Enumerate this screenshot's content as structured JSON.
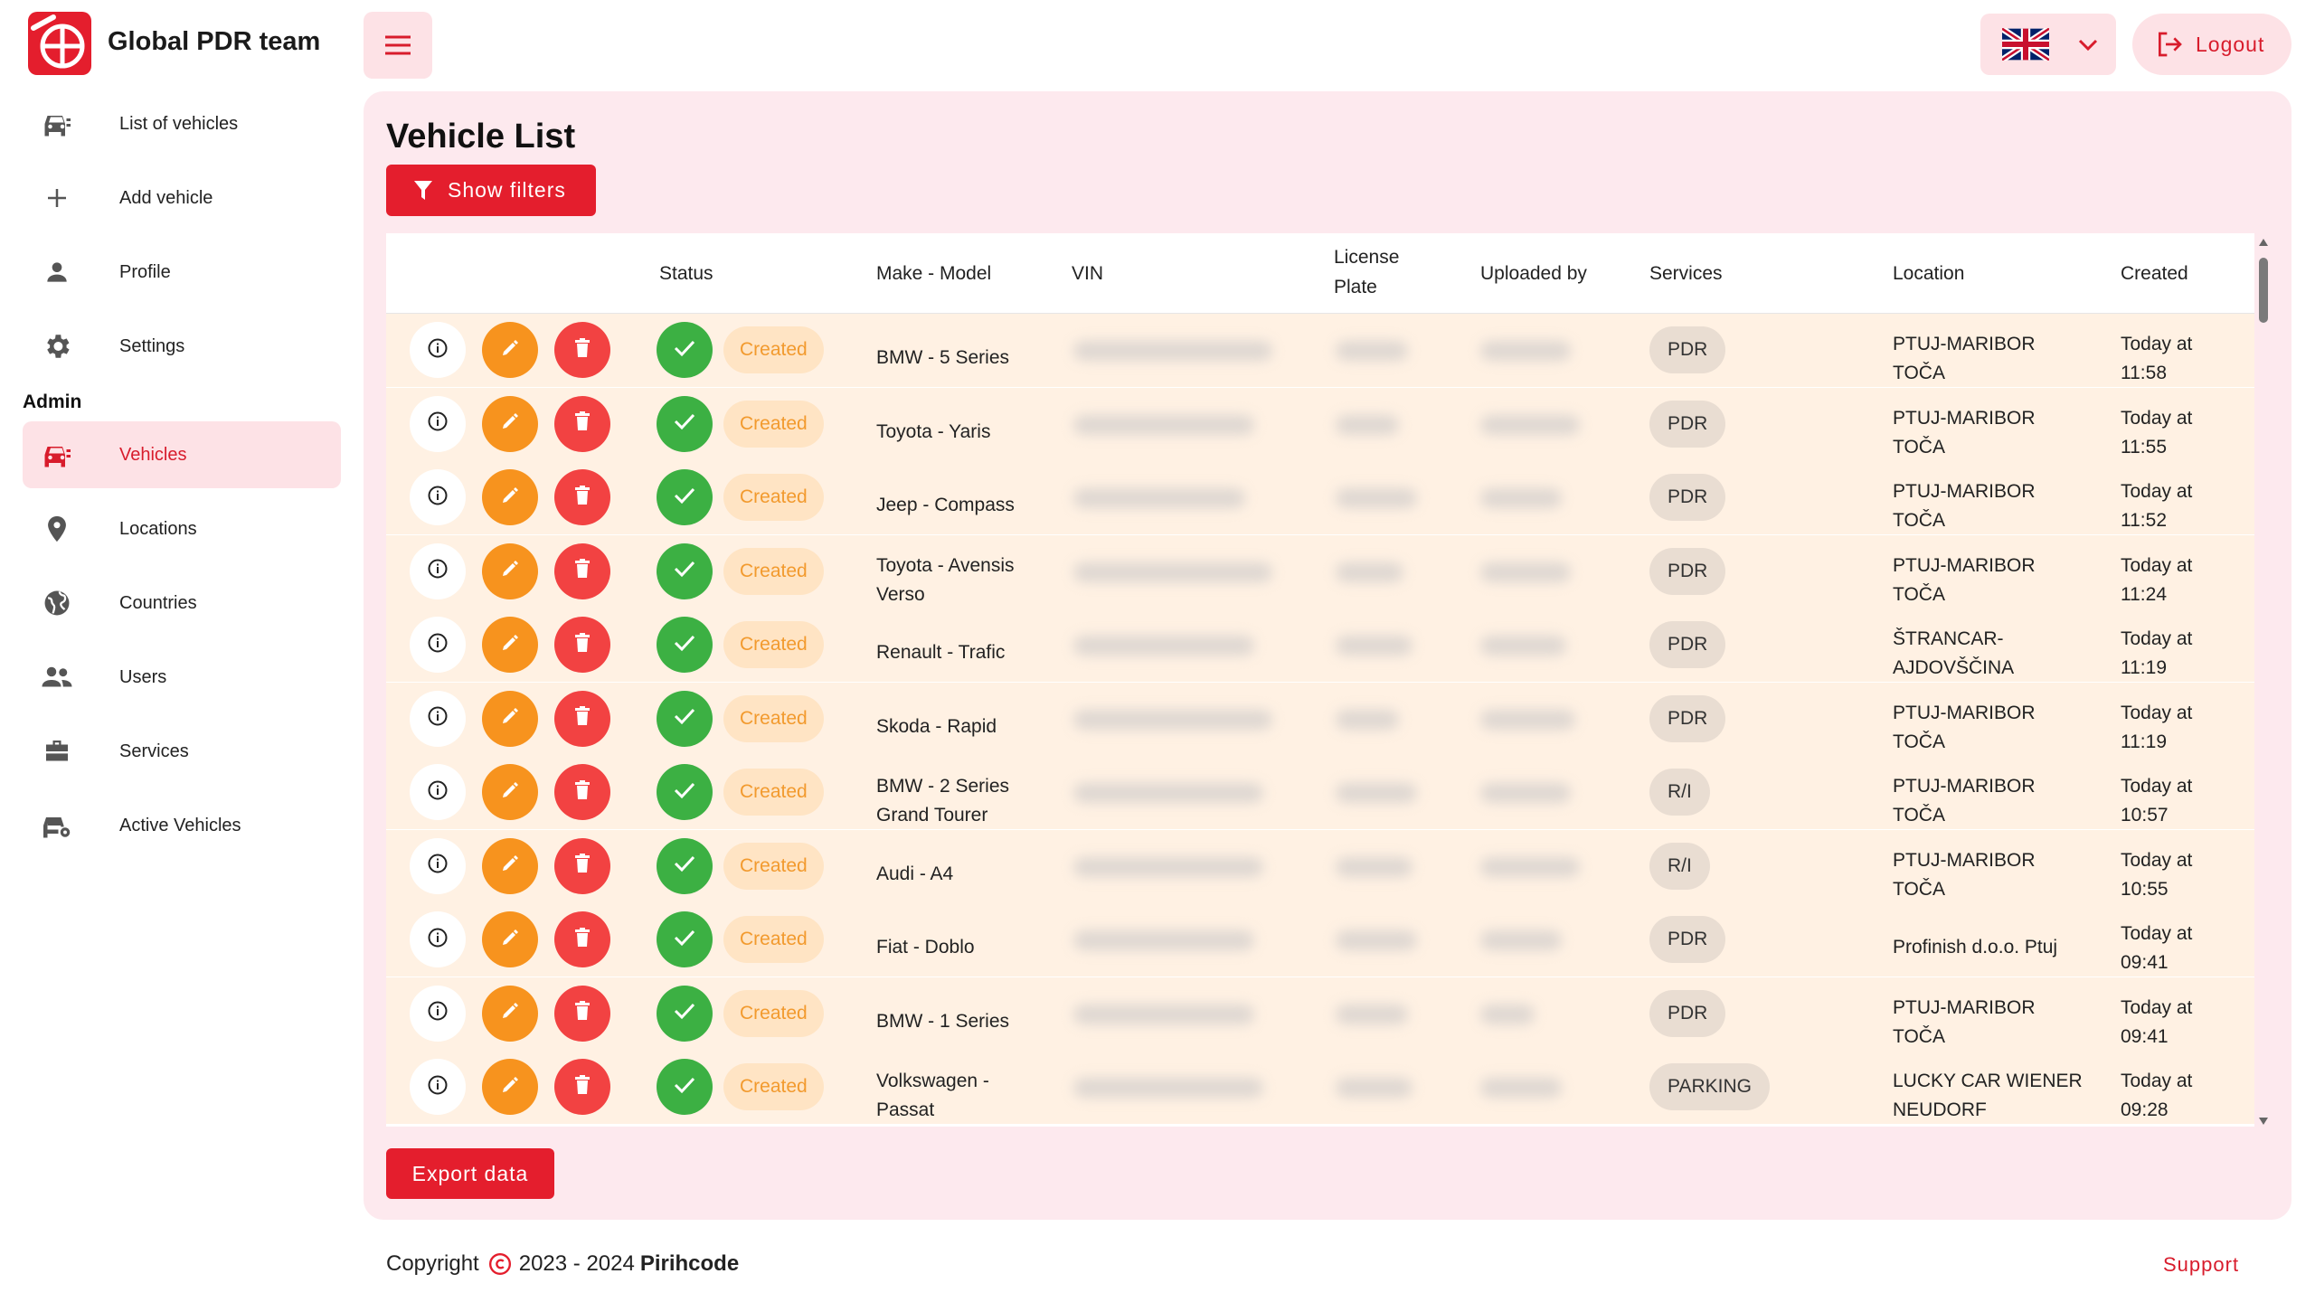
{
  "app": {
    "brand": "Global PDR team"
  },
  "sidebar": {
    "items": [
      {
        "label": "List of vehicles",
        "icon": "car-list-icon"
      },
      {
        "label": "Add vehicle",
        "icon": "plus-icon"
      },
      {
        "label": "Profile",
        "icon": "person-icon"
      },
      {
        "label": "Settings",
        "icon": "gear-icon"
      }
    ],
    "admin_label": "Admin",
    "admin_items": [
      {
        "label": "Vehicles",
        "icon": "car-icon",
        "active": true
      },
      {
        "label": "Locations",
        "icon": "location-pin-icon"
      },
      {
        "label": "Countries",
        "icon": "globe-icon"
      },
      {
        "label": "Users",
        "icon": "users-icon"
      },
      {
        "label": "Services",
        "icon": "toolbox-icon"
      },
      {
        "label": "Active Vehicles",
        "icon": "car-gear-icon"
      }
    ]
  },
  "topbar": {
    "language_flag": "uk-flag-icon",
    "logout_label": "Logout"
  },
  "main": {
    "title": "Vehicle List",
    "filters_label": "Show filters",
    "export_label": "Export data"
  },
  "table": {
    "headers": {
      "status": "Status",
      "make_model": "Make - Model",
      "vin": "VIN",
      "plate_1": "License",
      "plate_2": "Plate",
      "uploaded_by": "Uploaded by",
      "services": "Services",
      "location": "Location",
      "created": "Created"
    },
    "rows": [
      {
        "status": "Created",
        "model_1": "BMW - 5 Series",
        "model_2": "",
        "service": "PDR",
        "loc_1": "PTUJ-MARIBOR",
        "loc_2": "TOČA",
        "created_1": "Today at",
        "created_2": "11:58"
      },
      {
        "status": "Created",
        "model_1": "Toyota - Yaris",
        "model_2": "",
        "service": "PDR",
        "loc_1": "PTUJ-MARIBOR",
        "loc_2": "TOČA",
        "created_1": "Today at",
        "created_2": "11:55"
      },
      {
        "status": "Created",
        "model_1": "Jeep - Compass",
        "model_2": "",
        "service": "PDR",
        "loc_1": "PTUJ-MARIBOR",
        "loc_2": "TOČA",
        "created_1": "Today at",
        "created_2": "11:52"
      },
      {
        "status": "Created",
        "model_1": "Toyota - Avensis",
        "model_2": "Verso",
        "service": "PDR",
        "loc_1": "PTUJ-MARIBOR",
        "loc_2": "TOČA",
        "created_1": "Today at",
        "created_2": "11:24"
      },
      {
        "status": "Created",
        "model_1": "Renault - Trafic",
        "model_2": "",
        "service": "PDR",
        "loc_1": "ŠTRANCAR-",
        "loc_2": "AJDOVŠČINA",
        "created_1": "Today at",
        "created_2": "11:19"
      },
      {
        "status": "Created",
        "model_1": "Skoda - Rapid",
        "model_2": "",
        "service": "PDR",
        "loc_1": "PTUJ-MARIBOR",
        "loc_2": "TOČA",
        "created_1": "Today at",
        "created_2": "11:19"
      },
      {
        "status": "Created",
        "model_1": "BMW - 2 Series",
        "model_2": "Grand Tourer",
        "service": "R/I",
        "loc_1": "PTUJ-MARIBOR",
        "loc_2": "TOČA",
        "created_1": "Today at",
        "created_2": "10:57"
      },
      {
        "status": "Created",
        "model_1": "Audi - A4",
        "model_2": "",
        "service": "R/I",
        "loc_1": "PTUJ-MARIBOR",
        "loc_2": "TOČA",
        "created_1": "Today at",
        "created_2": "10:55"
      },
      {
        "status": "Created",
        "model_1": "Fiat - Doblo",
        "model_2": "",
        "service": "PDR",
        "loc_1": "Profinish d.o.o. Ptuj",
        "loc_2": "",
        "created_1": "Today at",
        "created_2": "09:41"
      },
      {
        "status": "Created",
        "model_1": "BMW - 1 Series",
        "model_2": "",
        "service": "PDR",
        "loc_1": "PTUJ-MARIBOR",
        "loc_2": "TOČA",
        "created_1": "Today at",
        "created_2": "09:41"
      },
      {
        "status": "Created",
        "model_1": "Volkswagen -",
        "model_2": "Passat",
        "service": "PARKING",
        "loc_1": "LUCKY CAR WIENER",
        "loc_2": "NEUDORF",
        "created_1": "Today at",
        "created_2": "09:28"
      }
    ]
  },
  "footer": {
    "copyright_label": "Copyright",
    "years": "2023 - 2024",
    "owner": "Pirihcode",
    "support_label": "Support"
  },
  "colors": {
    "accent": "#e41e2d",
    "accent_soft": "#fde2e6",
    "row_bg": "#fff1e3",
    "status_text": "#f29a2e",
    "ok": "#3cb043",
    "edit": "#f7931e",
    "delete": "#f24242"
  }
}
